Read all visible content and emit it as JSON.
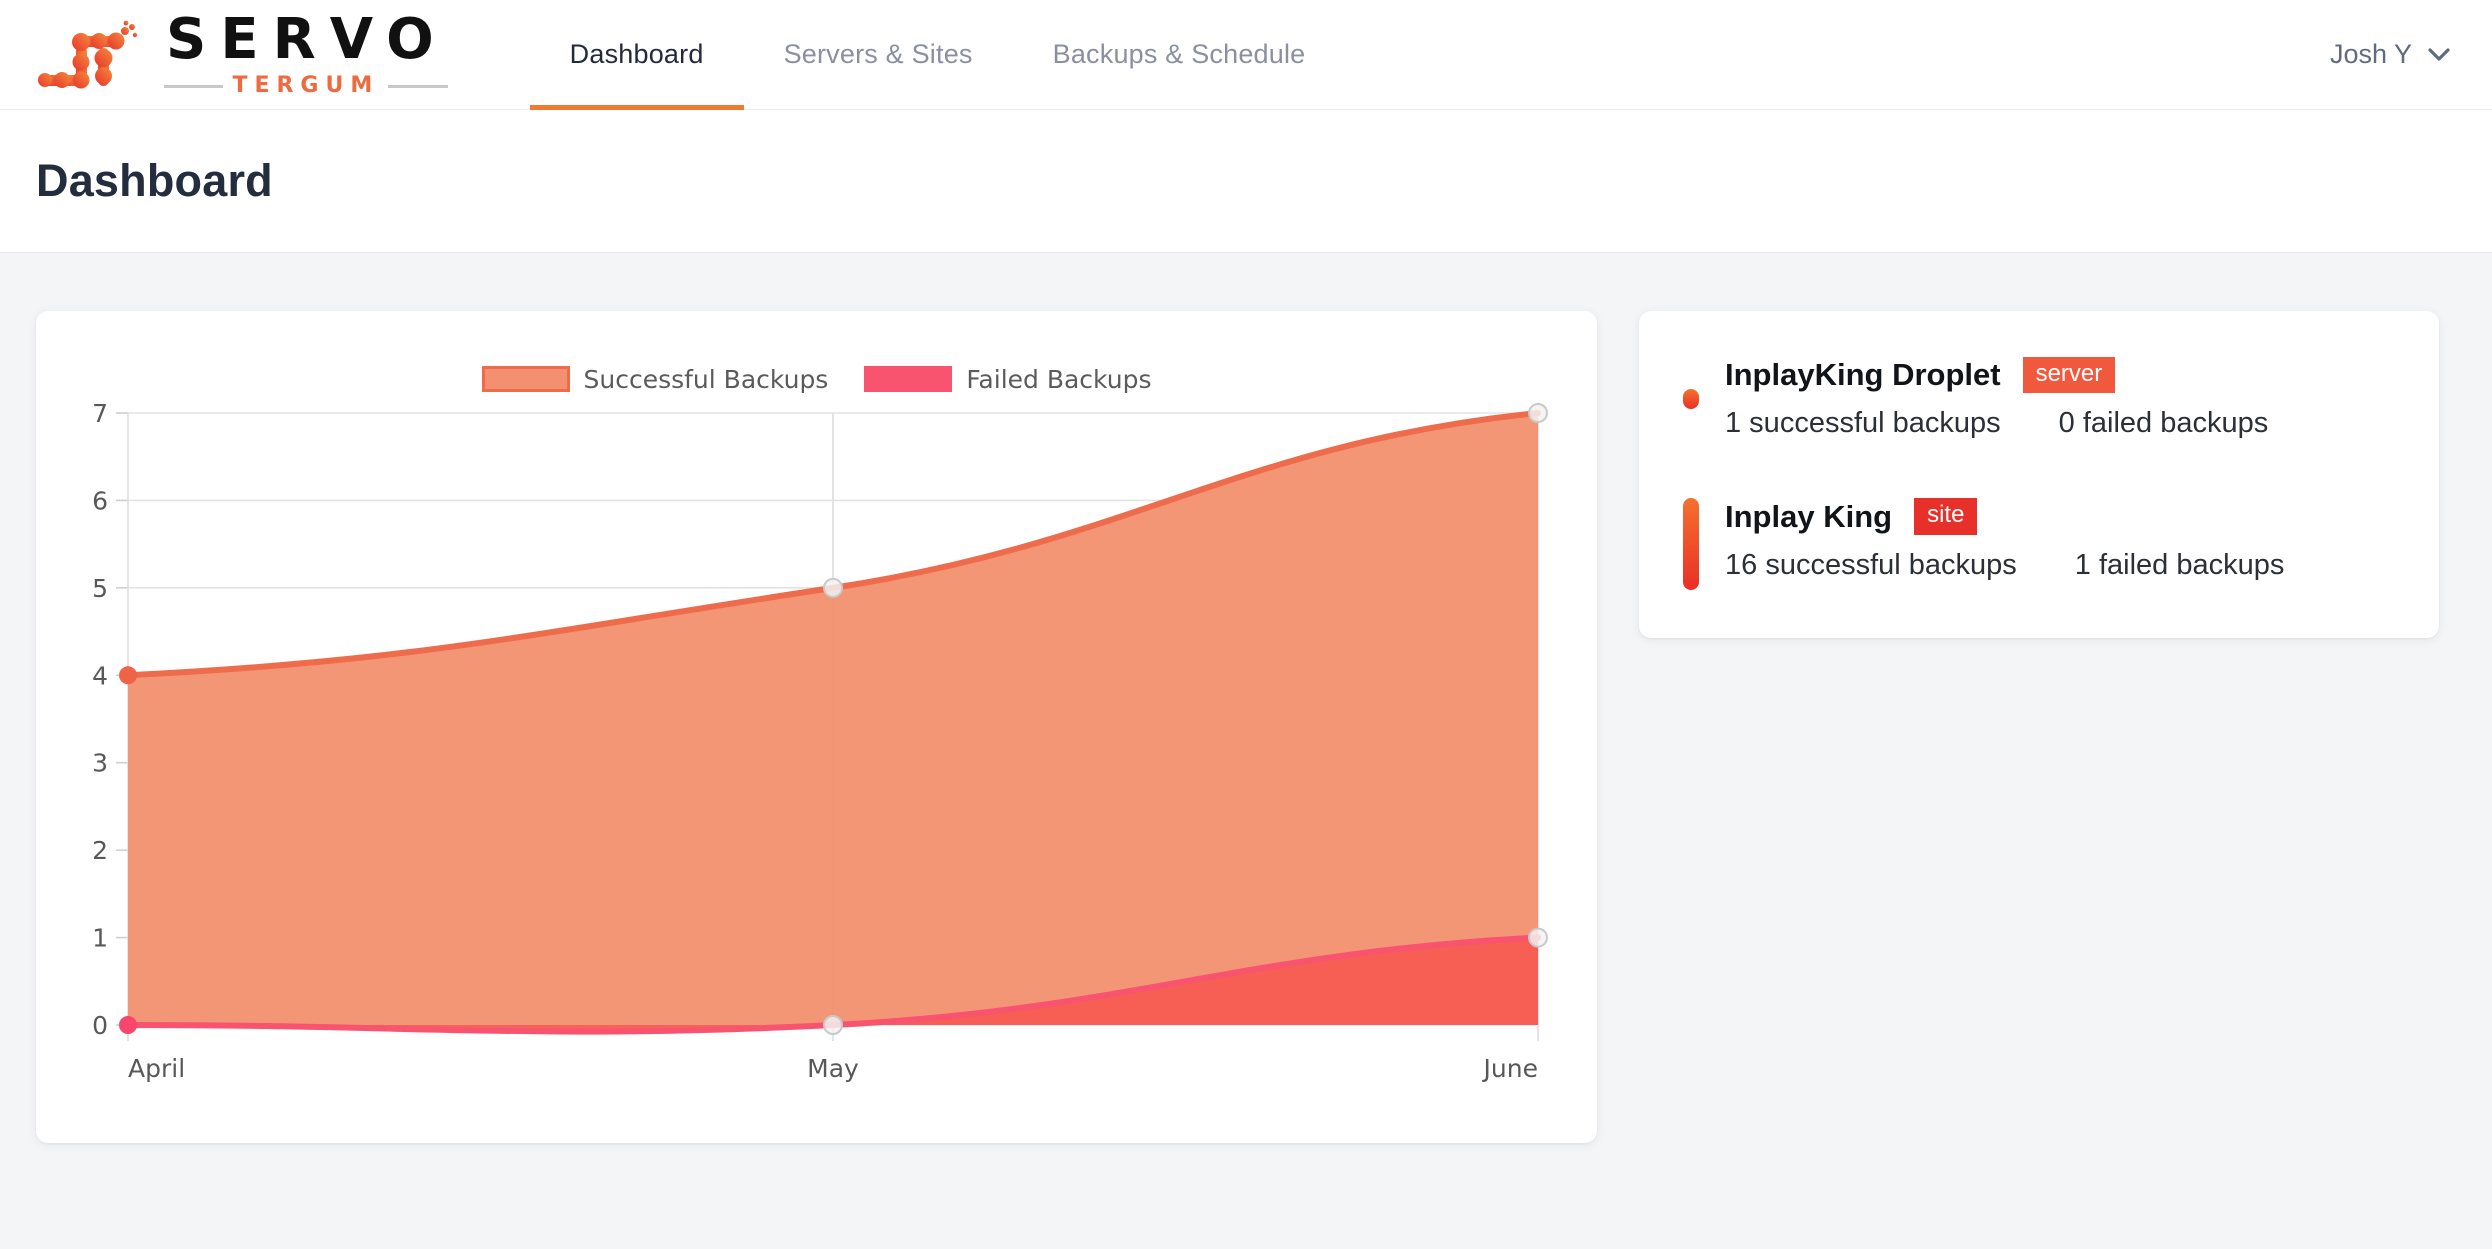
{
  "brand": {
    "name": "SERVO",
    "sub": "TERGUM",
    "logo_icon": "network-nodes-icon"
  },
  "nav": {
    "items": [
      {
        "label": "Dashboard",
        "active": true
      },
      {
        "label": "Servers & Sites",
        "active": false
      },
      {
        "label": "Backups & Schedule",
        "active": false
      }
    ],
    "active_color": "#ee7b32"
  },
  "user": {
    "name": "Josh Y",
    "chevron_icon": "chevron-down-icon"
  },
  "page": {
    "title": "Dashboard"
  },
  "chart_data": {
    "type": "area",
    "title": "",
    "xlabel": "",
    "ylabel": "",
    "categories": [
      "April",
      "May",
      "June"
    ],
    "ylim": [
      0,
      7
    ],
    "yticks": [
      0,
      1,
      2,
      3,
      4,
      5,
      6,
      7
    ],
    "grid": true,
    "legend_position": "top-center",
    "series": [
      {
        "name": "Successful Backups",
        "values": [
          4,
          5,
          7
        ],
        "fill": "#f2906f",
        "stroke": "#ee6c4c"
      },
      {
        "name": "Failed Backups",
        "values": [
          0,
          0,
          1
        ],
        "fill": "#f75b52",
        "stroke": "#f8546f"
      }
    ]
  },
  "entities": {
    "items": [
      {
        "name": "InplayKing Droplet",
        "badge": "server",
        "badge_color": "#f1593f",
        "successful": "1 successful backups",
        "failed": "0 failed backups",
        "marker": "dot"
      },
      {
        "name": "Inplay King",
        "badge": "site",
        "badge_color": "#e8302a",
        "successful": "16 successful backups",
        "failed": "1 failed backups",
        "marker": "bar"
      }
    ]
  }
}
